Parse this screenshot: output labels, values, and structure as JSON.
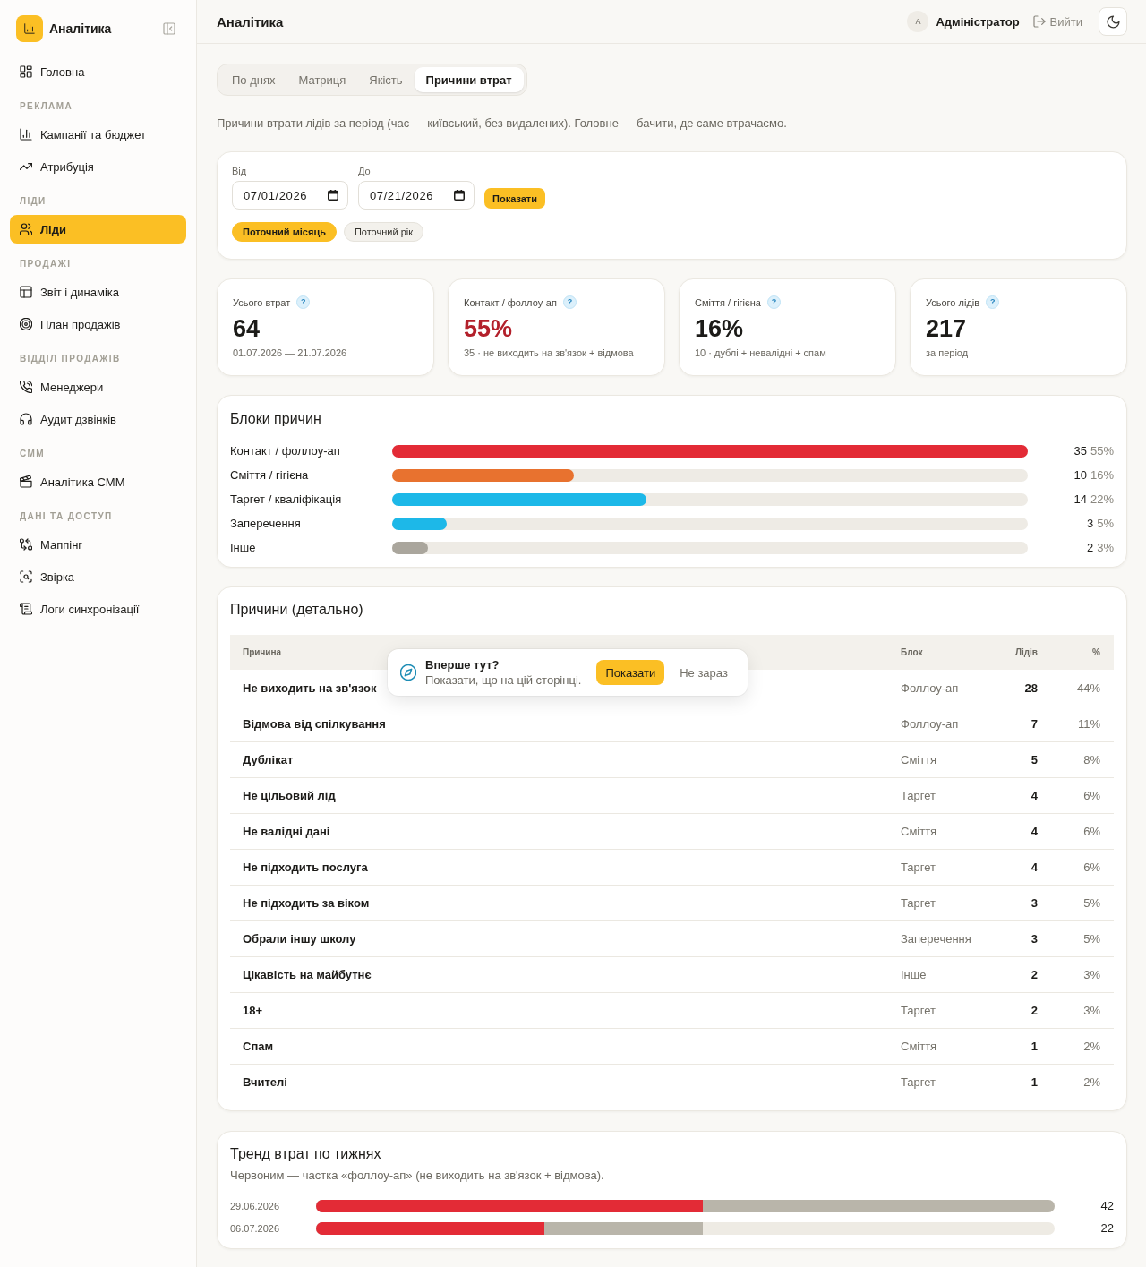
{
  "sidebar": {
    "brand": "Аналітика",
    "groups": [
      {
        "items": [
          {
            "label": "Головна",
            "selected": false
          }
        ]
      },
      {
        "title": "РЕКЛАМА",
        "items": [
          {
            "label": "Кампанії та бюджет",
            "selected": false
          },
          {
            "label": "Атрибуція",
            "selected": false
          }
        ]
      },
      {
        "title": "ЛІДИ",
        "items": [
          {
            "label": "Ліди",
            "selected": true
          }
        ]
      },
      {
        "title": "ПРОДАЖІ",
        "items": [
          {
            "label": "Звіт і динаміка",
            "selected": false
          },
          {
            "label": "План продажів",
            "selected": false
          }
        ]
      },
      {
        "title": "ВІДДІЛ ПРОДАЖІВ",
        "items": [
          {
            "label": "Менеджери",
            "selected": false
          },
          {
            "label": "Аудит дзвінків",
            "selected": false
          }
        ]
      },
      {
        "title": "СММ",
        "items": [
          {
            "label": "Аналітика СММ",
            "selected": false
          }
        ]
      },
      {
        "title": "ДАНІ ТА ДОСТУП",
        "items": [
          {
            "label": "Маппінг",
            "selected": false
          },
          {
            "label": "Звірка",
            "selected": false
          },
          {
            "label": "Логи синхронізації",
            "selected": false
          }
        ]
      }
    ]
  },
  "header": {
    "title": "Аналітика",
    "user": {
      "initial": "А",
      "name": "Адміністратор"
    },
    "logout": "Вийти"
  },
  "tabs": [
    {
      "label": "По днях",
      "selected": false
    },
    {
      "label": "Матриця",
      "selected": false
    },
    {
      "label": "Якість",
      "selected": false
    },
    {
      "label": "Причини втрат",
      "selected": true
    }
  ],
  "description": "Причини втрати лідів за період (час — київський, без видалених). Головне — бачити, де саме втрачаємо.",
  "filter": {
    "from": {
      "label": "Від",
      "value": "07/01/2026"
    },
    "to": {
      "label": "До",
      "value": "07/21/2026"
    },
    "submit": "Показати",
    "presets": [
      {
        "label": "Поточний місяць",
        "selected": true
      },
      {
        "label": "Поточний рік",
        "selected": false
      }
    ]
  },
  "kpis": [
    {
      "label": "Усього втрат",
      "hint": "?",
      "value": "64",
      "note": "01.07.2026 — 21.07.2026",
      "alert": false
    },
    {
      "label": "Контакт / фоллоу-ап",
      "hint": "?",
      "value": "55%",
      "note": "35 · не виходить на зв'язок + відмова",
      "alert": true
    },
    {
      "label": "Сміття / гігієна",
      "hint": "?",
      "value": "16%",
      "note": "10 · дублі + невалідні + спам",
      "alert": false
    },
    {
      "label": "Усього лідів",
      "hint": "?",
      "value": "217",
      "note": "за період",
      "alert": false
    }
  ],
  "blocks": {
    "title": "Блоки причин",
    "rows": [
      {
        "label": "Контакт / фоллоу-ап",
        "count": "35",
        "percent": "55%",
        "level": 1,
        "color": "#e32b36"
      },
      {
        "label": "Сміття / гігієна",
        "count": "10",
        "percent": "16%",
        "level": 0.286,
        "color": "#e8722f"
      },
      {
        "label": "Таргет / кваліфікація",
        "count": "14",
        "percent": "22%",
        "level": 0.4,
        "color": "#1db8e8"
      },
      {
        "label": "Заперечення",
        "count": "3",
        "percent": "5%",
        "level": 0.086,
        "color": "#1db8e8"
      },
      {
        "label": "Інше",
        "count": "2",
        "percent": "3%",
        "level": 0.057,
        "color": "#aaa69d"
      }
    ]
  },
  "details": {
    "title": "Причини (детально)",
    "columns": [
      "Причина",
      "Блок",
      "Лідів",
      "%"
    ],
    "rows": [
      {
        "reason": "Не виходить на зв'язок",
        "block": "Фоллоу-ап",
        "leads": "28",
        "percent": "44%"
      },
      {
        "reason": "Відмова від спілкування",
        "block": "Фоллоу-ап",
        "leads": "7",
        "percent": "11%"
      },
      {
        "reason": "Дублікат",
        "block": "Сміття",
        "leads": "5",
        "percent": "8%"
      },
      {
        "reason": "Не цільовий лід",
        "block": "Таргет",
        "leads": "4",
        "percent": "6%"
      },
      {
        "reason": "Не валідні дані",
        "block": "Сміття",
        "leads": "4",
        "percent": "6%"
      },
      {
        "reason": "Не підходить послуга",
        "block": "Таргет",
        "leads": "4",
        "percent": "6%"
      },
      {
        "reason": "Не підходить за віком",
        "block": "Таргет",
        "leads": "3",
        "percent": "5%"
      },
      {
        "reason": "Обрали іншу школу",
        "block": "Заперечення",
        "leads": "3",
        "percent": "5%"
      },
      {
        "reason": "Цікавість на майбутнє",
        "block": "Інше",
        "leads": "2",
        "percent": "3%"
      },
      {
        "reason": "18+",
        "block": "Таргет",
        "leads": "2",
        "percent": "3%"
      },
      {
        "reason": "Спам",
        "block": "Сміття",
        "leads": "1",
        "percent": "2%"
      },
      {
        "reason": "Вчителі",
        "block": "Таргет",
        "leads": "1",
        "percent": "2%"
      }
    ]
  },
  "tour_prompt": {
    "title": "Вперше тут?",
    "text": "Показати, що на цій сторінці.",
    "confirm": "Показати",
    "dismiss": "Не зараз"
  },
  "trend": {
    "title": "Тренд втрат по тижнях",
    "subtitle": "Червоним — частка «фоллоу-ап» (не виходить на зв'язок + відмова).",
    "weeks": [
      {
        "date": "29.06.2026",
        "total": "42",
        "level": 1,
        "followup": {
          "level": 0.524
        }
      },
      {
        "date": "06.07.2026",
        "total": "22",
        "level": 0.524,
        "followup": {
          "level": 0.309
        }
      }
    ]
  }
}
